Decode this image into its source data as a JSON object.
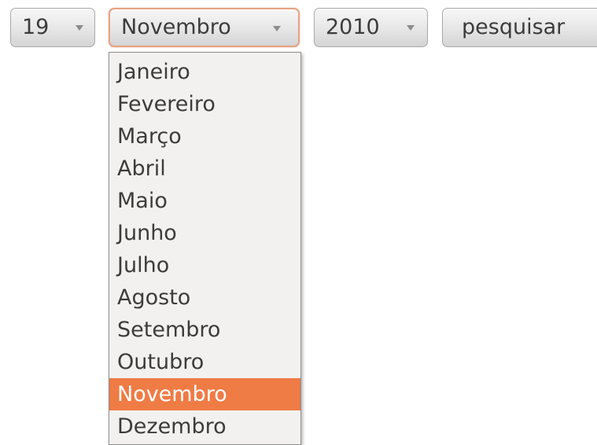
{
  "form": {
    "day": {
      "value": "19",
      "arrow_icon": "triangle-down"
    },
    "month": {
      "value": "Novembro",
      "arrow_icon": "triangle-down",
      "expanded": true
    },
    "year": {
      "value": "2010",
      "arrow_icon": "triangle-down"
    },
    "search_label": "pesquisar"
  },
  "month_dropdown": {
    "options": [
      "Janeiro",
      "Fevereiro",
      "Março",
      "Abril",
      "Maio",
      "Junho",
      "Julho",
      "Agosto",
      "Setembro",
      "Outubro",
      "Novembro",
      "Dezembro"
    ],
    "selected": "Novembro",
    "highlight_color": "#ef7b45"
  }
}
